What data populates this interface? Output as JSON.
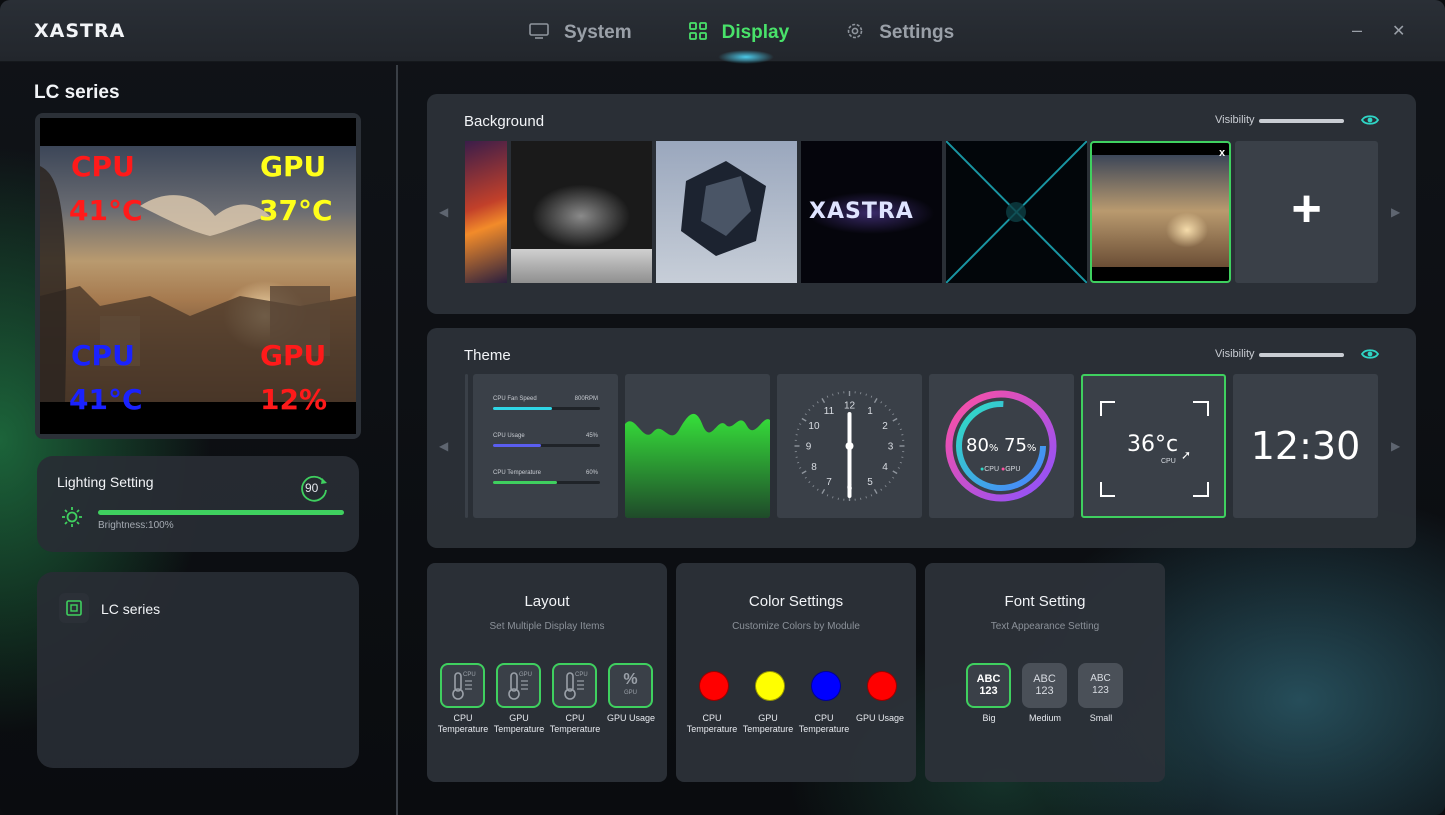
{
  "app": {
    "logo": "XASTRA"
  },
  "nav": {
    "tabs": [
      {
        "label": "System",
        "icon": "monitor-icon"
      },
      {
        "label": "Display",
        "icon": "grid-icon",
        "active": true
      },
      {
        "label": "Settings",
        "icon": "gear-icon"
      }
    ]
  },
  "window": {
    "minimize": "–",
    "close": "✕"
  },
  "left": {
    "title": "LC series",
    "preview": {
      "cpu_temp_label": "CPU",
      "cpu_temp_value": "41°C",
      "gpu_temp_label": "GPU",
      "gpu_temp_value": "37°C",
      "cpu_usage_label": "CPU",
      "cpu_usage_value": "41°C",
      "gpu_usage_label": "GPU",
      "gpu_usage_value": "12%"
    },
    "lighting": {
      "title": "Lighting Setting",
      "rotation": "90",
      "brightness_label": "Brightness:100%",
      "brightness_level": 1.0
    },
    "device": {
      "name": "LC series"
    }
  },
  "background": {
    "title": "Background",
    "visibility_label": "Visibility",
    "close_mark": "x",
    "add_symbol": "+",
    "thumb_logo": "XASTRA"
  },
  "theme": {
    "title": "Theme",
    "visibility_label": "Visibility",
    "bars": [
      {
        "label": "CPU Fan Speed",
        "value": "800RPM",
        "level": 0.55
      },
      {
        "label": "CPU Usage",
        "value": "45%",
        "level": 0.45
      },
      {
        "label": "CPU Temperature",
        "value": "60%",
        "level": 0.6
      }
    ],
    "clock_numbers": [
      "12",
      "1",
      "2",
      "3",
      "4",
      "5",
      "6",
      "7",
      "8",
      "9",
      "10",
      "11"
    ],
    "ring": {
      "left": "80",
      "right": "75",
      "unit": "%",
      "legend_cpu": "CPU",
      "legend_gpu": "GPU"
    },
    "temp_tile": {
      "value": "36°c",
      "label": "CPU"
    },
    "time": "12:30"
  },
  "layout_card": {
    "title": "Layout",
    "subtitle": "Set Multiple Display Items",
    "items": [
      {
        "tag": "CPU",
        "label1": "CPU",
        "label2": "Temperature"
      },
      {
        "tag": "GPU",
        "label1": "GPU",
        "label2": "Temperature"
      },
      {
        "tag": "CPU",
        "label1": "CPU",
        "label2": "Temperature"
      },
      {
        "tag": "GPU",
        "symbol": "%",
        "label1": "GPU Usage",
        "label2": ""
      }
    ]
  },
  "color_card": {
    "title": "Color Settings",
    "subtitle": "Customize Colors by Module",
    "items": [
      {
        "color": "#ff0000",
        "label1": "CPU",
        "label2": "Temperature"
      },
      {
        "color": "#ffff00",
        "label1": "GPU",
        "label2": "Temperature"
      },
      {
        "color": "#0000ff",
        "label1": "CPU",
        "label2": "Temperature"
      },
      {
        "color": "#ff0000",
        "label1": "GPU Usage",
        "label2": ""
      }
    ]
  },
  "font_card": {
    "title": "Font Setting",
    "subtitle": "Text Appearance Setting",
    "items": [
      {
        "abc": "ABC",
        "num": "123",
        "label": "Big"
      },
      {
        "abc": "ABC",
        "num": "123",
        "label": "Medium"
      },
      {
        "abc": "ABC",
        "num": "123",
        "label": "Small"
      }
    ]
  },
  "colors": {
    "accent": "#3fd05f",
    "nav_active": "#49e26a",
    "eye": "#2fd6c6"
  }
}
